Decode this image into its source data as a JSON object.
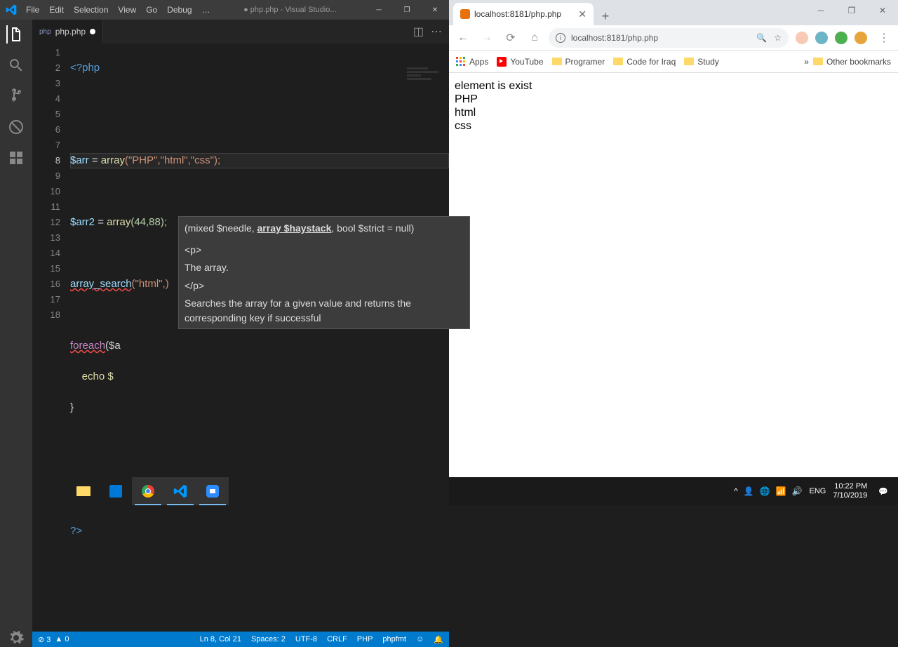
{
  "vscode": {
    "menu": [
      "File",
      "Edit",
      "Selection",
      "View",
      "Go",
      "Debug",
      "…"
    ],
    "title": "● php.php - Visual Studio...",
    "tab": {
      "name": "php.php",
      "modified": true
    },
    "lines": [
      1,
      2,
      3,
      4,
      5,
      6,
      7,
      8,
      9,
      10,
      11,
      12,
      13,
      14,
      15,
      16,
      17,
      18
    ],
    "code": {
      "l1_open": "<?php",
      "l4_var": "$arr",
      "l4_eq": " = ",
      "l4_fn": "array",
      "l4_args": "(\"PHP\",\"html\",\"css\");",
      "l6_var": "$arr2",
      "l6_eq": " = ",
      "l6_fn": "array",
      "l6_args": "(44,88);",
      "l8_fn": "array_search",
      "l8_args": "(\"html\",)",
      "l10_kw": "foreach",
      "l10_rest": "($a",
      "l11_echo": "    echo $",
      "l12_brace": "}",
      "l16_close": "?>"
    },
    "tooltip": {
      "sig_pre": "(mixed $needle, ",
      "sig_active": "array $haystack",
      "sig_post": ", bool $strict = null)",
      "ptag_open": "<p>",
      "pcontent": "The array.",
      "ptag_close": "</p>",
      "desc": "Searches the array for a given value and returns the corresponding key if successful"
    },
    "status": {
      "errors": "⊘ 3",
      "warnings": "▲ 0",
      "pos": "Ln 8, Col 21",
      "spaces": "Spaces: 2",
      "enc": "UTF-8",
      "eol": "CRLF",
      "lang": "PHP",
      "fmt": "phpfmt"
    }
  },
  "chrome": {
    "tab_title": "localhost:8181/php.php",
    "url": "localhost:8181/php.php",
    "bookmarks": [
      {
        "name": "Apps",
        "type": "apps"
      },
      {
        "name": "YouTube",
        "type": "yt"
      },
      {
        "name": "Programer",
        "type": "folder"
      },
      {
        "name": "Code for Iraq",
        "type": "folder"
      },
      {
        "name": "Study",
        "type": "folder"
      }
    ],
    "bookmarks_more": "»",
    "other_bookmarks": "Other bookmarks",
    "page_lines": [
      "element is exist",
      "PHP",
      "html",
      "css"
    ]
  },
  "taskbar": {
    "lang": "ENG",
    "time": "10:22 PM",
    "date": "7/10/2019"
  }
}
